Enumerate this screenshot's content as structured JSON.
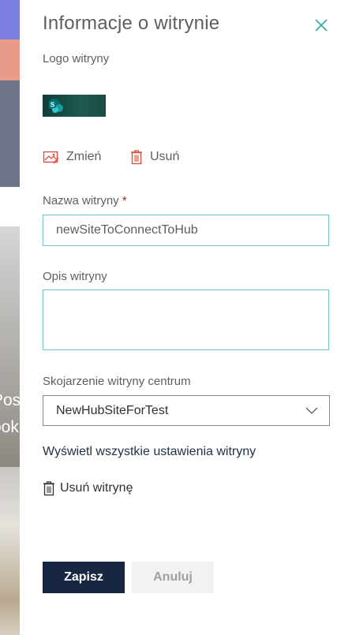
{
  "background": {
    "text_line1": "Pos",
    "text_line2": "ook"
  },
  "panel": {
    "title": "Informacje o witrynie",
    "close_icon": "close-icon"
  },
  "logo": {
    "label": "Logo witryny",
    "change_label": "Zmień",
    "remove_label": "Usuń"
  },
  "site_name": {
    "label": "Nazwa witryny",
    "required_mark": "*",
    "value": "newSiteToConnectToHub"
  },
  "site_description": {
    "label": "Opis witryny",
    "value": ""
  },
  "hub": {
    "label": "Skojarzenie witryny centrum",
    "selected": "NewHubSiteForTest"
  },
  "links": {
    "all_settings": "Wyświetl wszystkie ustawienia witryny",
    "delete_site": "Usuń witrynę"
  },
  "buttons": {
    "save": "Zapisz",
    "cancel": "Anuluj"
  },
  "colors": {
    "accent": "#172742",
    "icon_red": "#d9503f",
    "field_border": "#77c2c0",
    "required": "#a4262c"
  }
}
